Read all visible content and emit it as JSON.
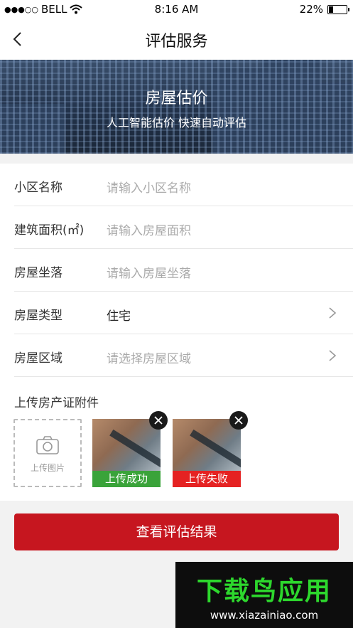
{
  "status_bar": {
    "carrier": "BELL",
    "time": "8:16 AM",
    "battery": "22%"
  },
  "nav": {
    "title": "评估服务"
  },
  "banner": {
    "title": "房屋估价",
    "subtitle": "人工智能估价 快速自动评估"
  },
  "form": {
    "rows": [
      {
        "label": "小区名称",
        "placeholder": "请输入小区名称"
      },
      {
        "label": "建筑面积(㎡)",
        "placeholder": "请输入房屋面积"
      },
      {
        "label": "房屋坐落",
        "placeholder": "请输入房屋坐落"
      },
      {
        "label": "房屋类型",
        "value": "住宅"
      },
      {
        "label": "房屋区域",
        "placeholder": "请选择房屋区域"
      }
    ]
  },
  "upload": {
    "title": "上传房产证附件",
    "add_label": "上传图片",
    "items": [
      {
        "status": "上传成功"
      },
      {
        "status": "上传失败"
      }
    ]
  },
  "submit_label": "查看评估结果",
  "watermark": {
    "logo": "下载鸟应用",
    "url": "www.xiazainiao.com"
  },
  "colors": {
    "accent": "#c6161f",
    "success": "#3aa33a",
    "fail": "#e52222"
  }
}
